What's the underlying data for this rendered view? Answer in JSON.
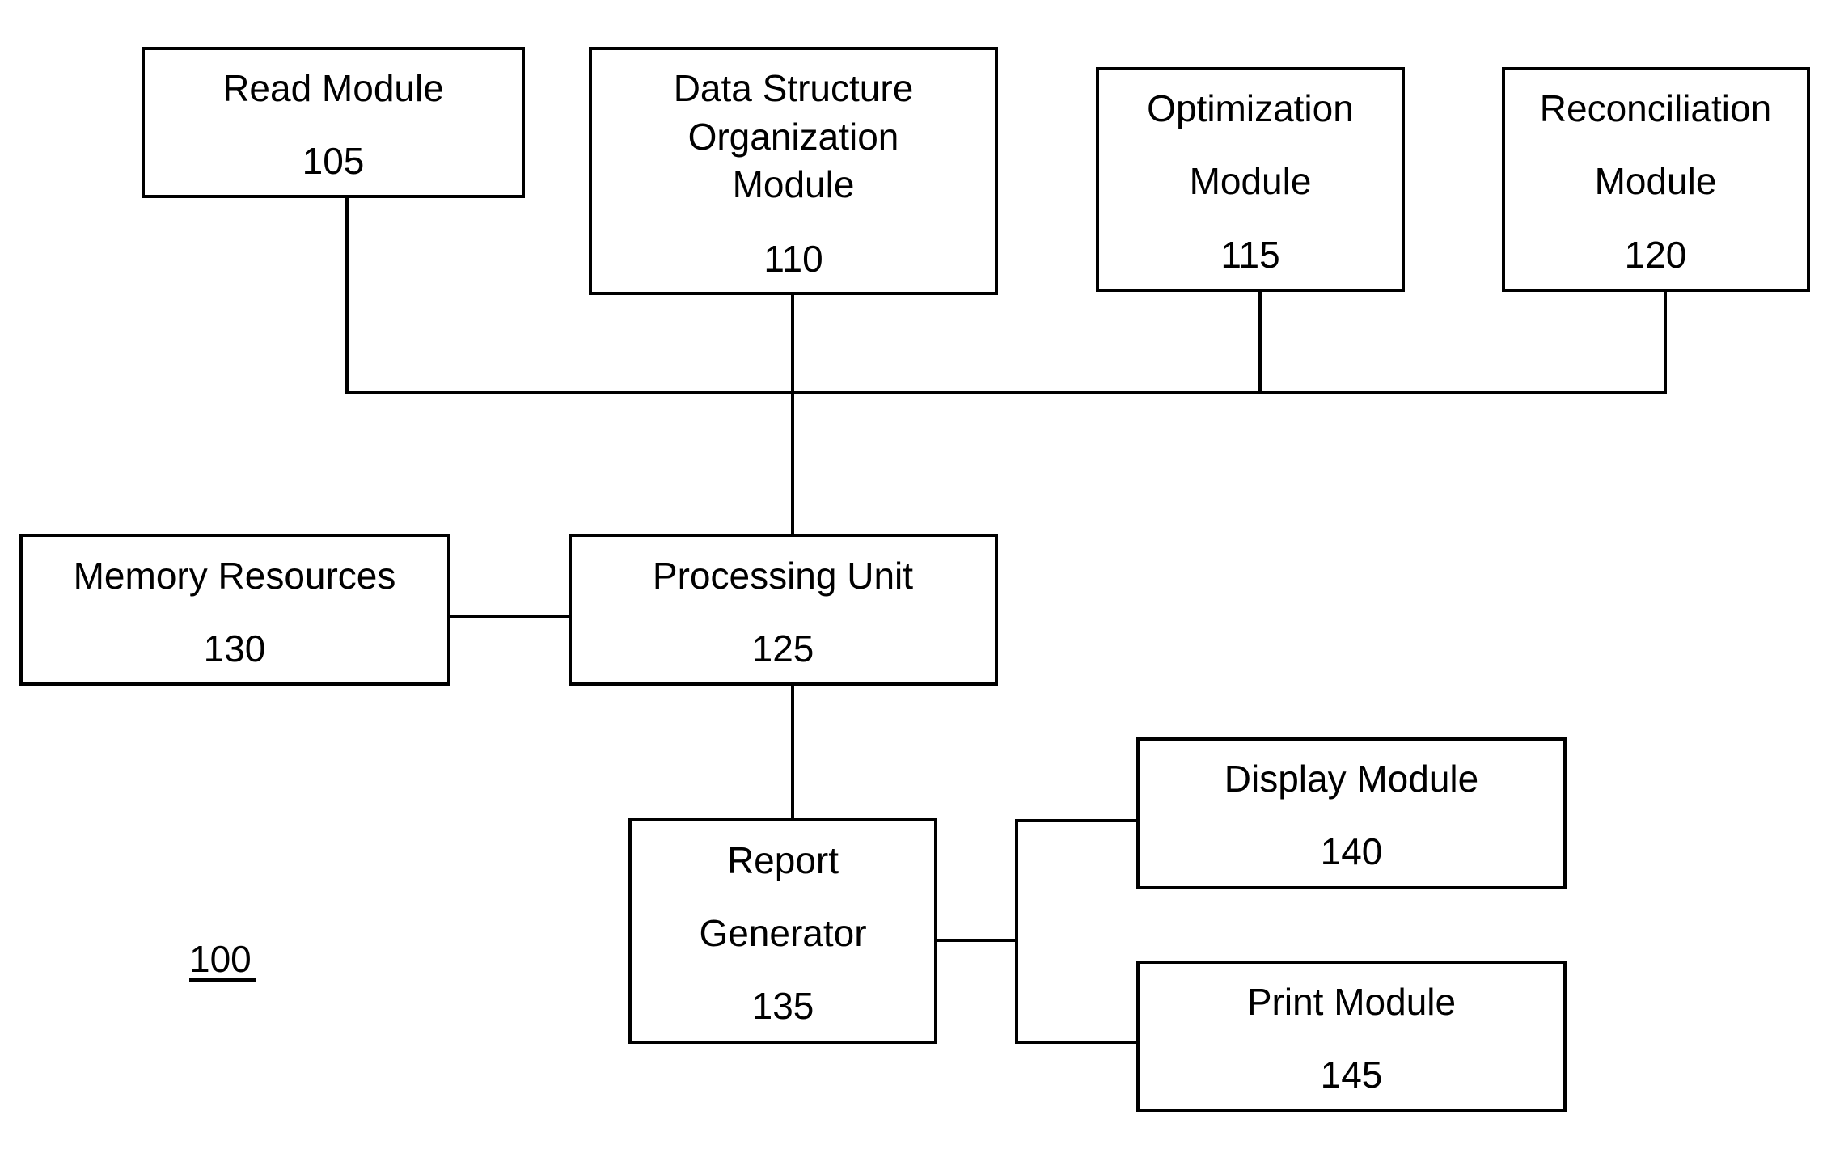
{
  "figure": {
    "reference_label": "100",
    "modules": {
      "read": {
        "lines": [
          "Read Module"
        ],
        "number": "105"
      },
      "dso": {
        "lines": [
          "Data Structure",
          "Organization",
          "Module"
        ],
        "number": "110"
      },
      "optimization": {
        "lines": [
          "Optimization",
          "Module"
        ],
        "number": "115"
      },
      "reconciliation": {
        "lines": [
          "Reconciliation",
          "Module"
        ],
        "number": "120"
      },
      "processing": {
        "lines": [
          "Processing Unit"
        ],
        "number": "125"
      },
      "memory": {
        "lines": [
          "Memory Resources"
        ],
        "number": "130"
      },
      "report": {
        "lines": [
          "Report",
          "Generator"
        ],
        "number": "135"
      },
      "display": {
        "lines": [
          "Display Module"
        ],
        "number": "140"
      },
      "print": {
        "lines": [
          "Print Module"
        ],
        "number": "145"
      }
    },
    "connections": [
      [
        "read",
        "bus"
      ],
      [
        "dso",
        "bus"
      ],
      [
        "optimization",
        "bus"
      ],
      [
        "reconciliation",
        "bus"
      ],
      [
        "bus",
        "processing"
      ],
      [
        "memory",
        "processing"
      ],
      [
        "processing",
        "report"
      ],
      [
        "report",
        "display"
      ],
      [
        "report",
        "print"
      ]
    ]
  }
}
